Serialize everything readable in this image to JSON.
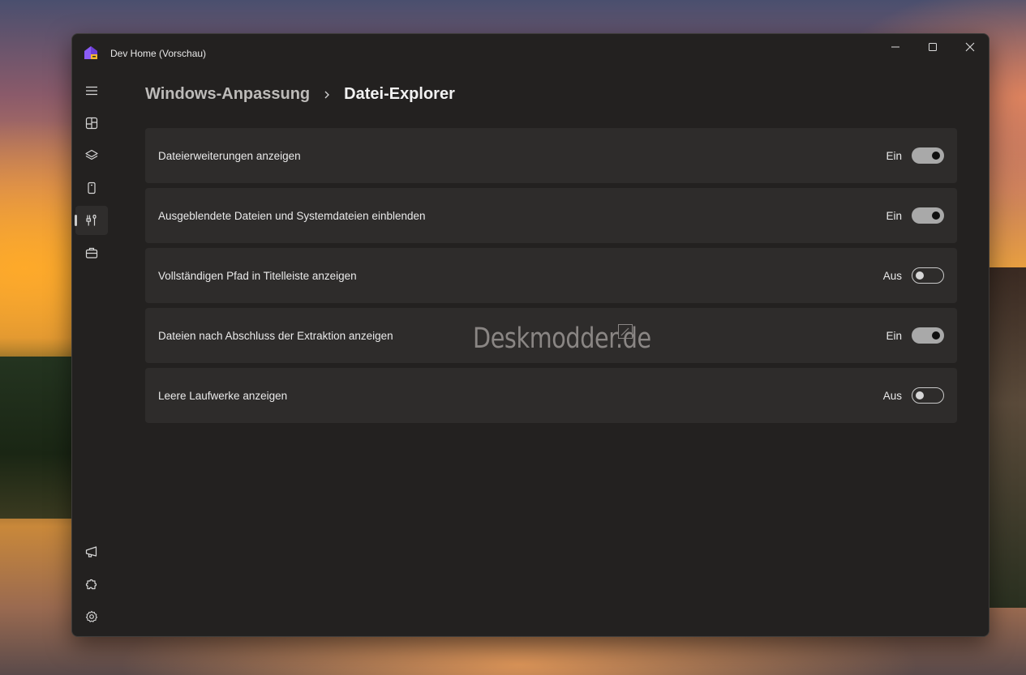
{
  "window": {
    "title": "Dev Home (Vorschau)"
  },
  "breadcrumb": {
    "parent": "Windows-Anpassung",
    "current": "Datei-Explorer"
  },
  "nav": {
    "items": [
      {
        "icon": "menu-icon"
      },
      {
        "icon": "dashboard-icon"
      },
      {
        "icon": "layers-icon"
      },
      {
        "icon": "device-icon"
      },
      {
        "icon": "tools-icon",
        "active": true
      },
      {
        "icon": "briefcase-icon"
      }
    ],
    "footer": [
      {
        "icon": "megaphone-icon"
      },
      {
        "icon": "extensions-icon"
      },
      {
        "icon": "settings-gear-icon"
      }
    ]
  },
  "settings": [
    {
      "label": "Dateierweiterungen anzeigen",
      "state": "Ein",
      "on": true
    },
    {
      "label": "Ausgeblendete Dateien und Systemdateien einblenden",
      "state": "Ein",
      "on": true
    },
    {
      "label": "Vollständigen Pfad in Titelleiste anzeigen",
      "state": "Aus",
      "on": false
    },
    {
      "label": "Dateien nach Abschluss der Extraktion anzeigen",
      "state": "Ein",
      "on": true
    },
    {
      "label": "Leere Laufwerke anzeigen",
      "state": "Aus",
      "on": false
    }
  ],
  "watermark": "Deskmodder.de",
  "colors": {
    "window_bg": "#232120",
    "card_bg": "#2e2c2b",
    "toggle_on": "#a9a9a9"
  }
}
